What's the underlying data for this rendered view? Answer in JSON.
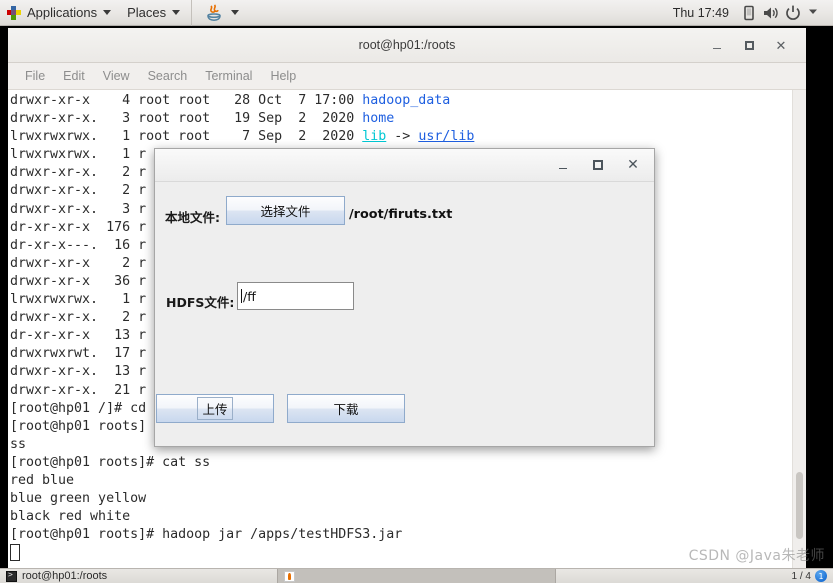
{
  "top_panel": {
    "applications_label": "Applications",
    "places_label": "Places",
    "app_icon": "apps-grid-icon",
    "java_icon": "java-coffee-icon",
    "clock": "Thu 17:49",
    "tray": [
      {
        "name": "display-icon",
        "glyph": "□"
      },
      {
        "name": "volume-icon",
        "glyph": "🔊"
      },
      {
        "name": "power-icon",
        "glyph": "⏻"
      },
      {
        "name": "chevron-down-icon",
        "glyph": "▾"
      }
    ]
  },
  "terminal": {
    "title": "root@hp01:/roots",
    "window_buttons": {
      "minimize": "minimize-button",
      "maximize": "maximize-button",
      "close": "close-button",
      "close_glyph": "✕"
    },
    "menu": [
      "File",
      "Edit",
      "View",
      "Search",
      "Terminal",
      "Help"
    ],
    "lines": [
      {
        "plain": "drwxr-xr-x    4 root root   28 Oct  7 17:00 ",
        "dir": "hadoop_data"
      },
      {
        "plain": "drwxr-xr-x.   3 root root   19 Sep  2  2020 ",
        "dir": "home"
      },
      {
        "plain": "lrwxrwxrwx.   1 root root    7 Sep  2  2020 ",
        "link": "lib",
        "arrow": " -> ",
        "target": "usr/lib"
      },
      {
        "plain": "lrwxrwxrwx.   1 r"
      },
      {
        "plain": "drwxr-xr-x.   2 r"
      },
      {
        "plain": "drwxr-xr-x.   2 r"
      },
      {
        "plain": "drwxr-xr-x.   3 r"
      },
      {
        "plain": "dr-xr-xr-x  176 r"
      },
      {
        "plain": "dr-xr-x---.  16 r"
      },
      {
        "plain": "drwxr-xr-x    2 r"
      },
      {
        "plain": "drwxr-xr-x   36 r"
      },
      {
        "plain": "lrwxrwxrwx.   1 r"
      },
      {
        "plain": "drwxr-xr-x.   2 r"
      },
      {
        "plain": "dr-xr-xr-x   13 r"
      },
      {
        "plain": "drwxrwxrwt.  17 r"
      },
      {
        "plain": "drwxr-xr-x.  13 r"
      },
      {
        "plain": "drwxr-xr-x.  21 r"
      },
      {
        "plain": "[root@hp01 /]# cd"
      },
      {
        "plain": "[root@hp01 roots]"
      },
      {
        "plain": "ss"
      },
      {
        "plain": "[root@hp01 roots]# cat ss"
      },
      {
        "plain": "red blue"
      },
      {
        "plain": "blue green yellow"
      },
      {
        "plain": "black red white"
      },
      {
        "plain": "[root@hp01 roots]# hadoop jar /apps/testHDFS3.jar"
      },
      {
        "plain": "",
        "cursor": true
      }
    ],
    "colors": {
      "directory": "#1e5fe0",
      "symlink": "#00c8d4",
      "text": "#2b2b2b",
      "background": "#ffffff"
    }
  },
  "dialog": {
    "title": "",
    "window_buttons": {
      "minimize": "minimize-button",
      "maximize": "maximize-button",
      "close": "close-button",
      "close_glyph": "✕"
    },
    "local_file_label": "本地文件:",
    "choose_file_button": "选择文件",
    "local_file_path": "/root/firuts.txt",
    "hdfs_file_label": "HDFS文件:",
    "hdfs_file_value": "/ff",
    "upload_button": "上传",
    "download_button": "下载"
  },
  "bottom_panel": {
    "tasks": [
      {
        "name": "taskbar-item-terminal",
        "label": "root@hp01:/roots",
        "icon": "terminal-icon",
        "active": false
      },
      {
        "name": "taskbar-item-java",
        "label": "",
        "icon": "java-icon",
        "active": true
      }
    ],
    "workspace_indicator": "1 / 4",
    "workspace_badge": "1"
  },
  "watermark": "CSDN @Java朱老师"
}
